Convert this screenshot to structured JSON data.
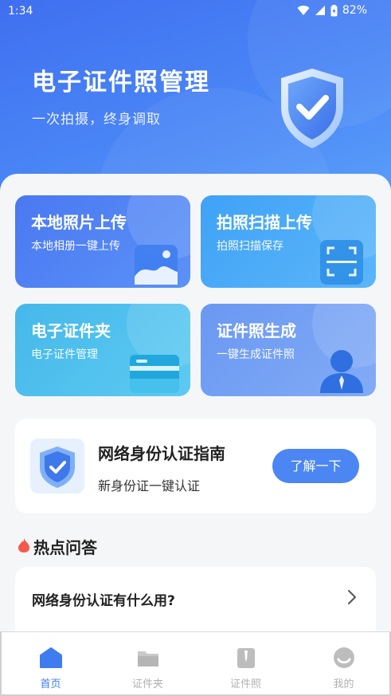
{
  "status_bar": {
    "time": "1:34",
    "battery": "82%"
  },
  "hero": {
    "title": "电子证件照管理",
    "subtitle": "一次拍摄，终身调取"
  },
  "cards": [
    {
      "title": "本地照片上传",
      "subtitle": "本地相册一键上传",
      "icon": "gallery-icon"
    },
    {
      "title": "拍照扫描上传",
      "subtitle": "拍照扫描保存",
      "icon": "scan-icon"
    },
    {
      "title": "电子证件夹",
      "subtitle": "电子证件管理",
      "icon": "card-icon"
    },
    {
      "title": "证件照生成",
      "subtitle": "一键生成证件照",
      "icon": "person-icon"
    }
  ],
  "guide": {
    "title": "网络身份认证指南",
    "subtitle": "新身份证一键认证",
    "button_label": "了解一下"
  },
  "hot": {
    "title": "热点问答",
    "items": [
      {
        "question": "网络身份认证有什么用?"
      }
    ]
  },
  "tabbar": {
    "active": 0,
    "items": [
      {
        "label": "首页",
        "icon": "home-icon"
      },
      {
        "label": "证件夹",
        "icon": "folder-icon"
      },
      {
        "label": "证件照",
        "icon": "id-photo-icon"
      },
      {
        "label": "我的",
        "icon": "profile-icon"
      }
    ]
  },
  "colors": {
    "primary": "#4b86f3",
    "tab_inactive": "#b0b0b0",
    "tab_active": "#3e7cf0"
  }
}
